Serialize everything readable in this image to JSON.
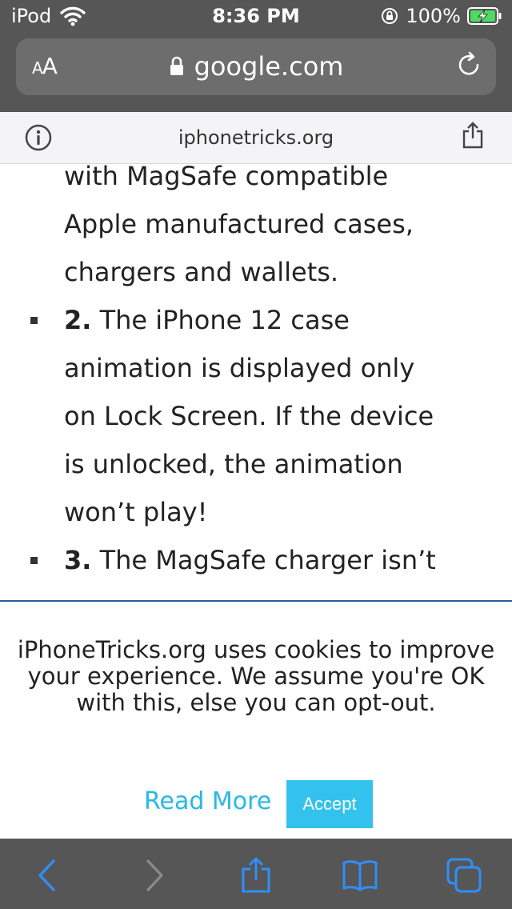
{
  "status_bar": {
    "device": "iPod",
    "time": "8:36 PM",
    "battery": "100%"
  },
  "address_bar": {
    "text_size_label_small": "A",
    "text_size_label_large": "A",
    "url": "google.com"
  },
  "site_bar": {
    "site_name": "iphonetricks.org"
  },
  "article": {
    "continued_lines": [
      "with MagSafe compatible",
      "Apple manufactured cases,",
      "chargers and wallets."
    ],
    "items": [
      {
        "number": "2.",
        "lines": [
          "The iPhone 12 case",
          "animation is displayed only",
          "on Lock Screen. If the device",
          "is unlocked, the animation",
          "won’t play!"
        ]
      },
      {
        "number": "3.",
        "lines": [
          "The MagSafe charger isn’t"
        ]
      }
    ]
  },
  "cookie_banner": {
    "message": "iPhoneTricks.org uses cookies to improve your experience. We assume you're OK with this, else you can opt-out.",
    "read_more_label": "Read More",
    "accept_label": "Accept",
    "link_color": "#27b8e8",
    "accept_color": "#33c2ee"
  },
  "toolbar": {
    "icons": [
      "back-icon",
      "forward-icon",
      "share-icon",
      "bookmarks-icon",
      "tabs-icon"
    ],
    "active_color": "#2f8fff",
    "disabled_color": "#8b8b8b"
  },
  "theme": {
    "chrome_color": "#565656",
    "address_field_color": "#6d6d6d"
  }
}
